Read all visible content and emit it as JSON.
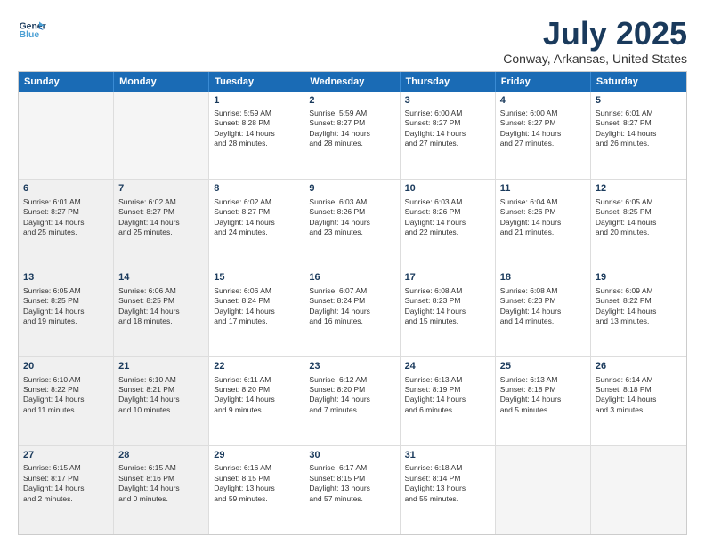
{
  "header": {
    "logo_general": "General",
    "logo_blue": "Blue",
    "month_title": "July 2025",
    "location": "Conway, Arkansas, United States"
  },
  "calendar": {
    "days_of_week": [
      "Sunday",
      "Monday",
      "Tuesday",
      "Wednesday",
      "Thursday",
      "Friday",
      "Saturday"
    ],
    "rows": [
      [
        {
          "day": "",
          "empty": true
        },
        {
          "day": "",
          "empty": true
        },
        {
          "day": "1",
          "lines": [
            "Sunrise: 5:59 AM",
            "Sunset: 8:28 PM",
            "Daylight: 14 hours",
            "and 28 minutes."
          ]
        },
        {
          "day": "2",
          "lines": [
            "Sunrise: 5:59 AM",
            "Sunset: 8:27 PM",
            "Daylight: 14 hours",
            "and 28 minutes."
          ]
        },
        {
          "day": "3",
          "lines": [
            "Sunrise: 6:00 AM",
            "Sunset: 8:27 PM",
            "Daylight: 14 hours",
            "and 27 minutes."
          ]
        },
        {
          "day": "4",
          "lines": [
            "Sunrise: 6:00 AM",
            "Sunset: 8:27 PM",
            "Daylight: 14 hours",
            "and 27 minutes."
          ]
        },
        {
          "day": "5",
          "lines": [
            "Sunrise: 6:01 AM",
            "Sunset: 8:27 PM",
            "Daylight: 14 hours",
            "and 26 minutes."
          ]
        }
      ],
      [
        {
          "day": "6",
          "shaded": true,
          "lines": [
            "Sunrise: 6:01 AM",
            "Sunset: 8:27 PM",
            "Daylight: 14 hours",
            "and 25 minutes."
          ]
        },
        {
          "day": "7",
          "shaded": true,
          "lines": [
            "Sunrise: 6:02 AM",
            "Sunset: 8:27 PM",
            "Daylight: 14 hours",
            "and 25 minutes."
          ]
        },
        {
          "day": "8",
          "lines": [
            "Sunrise: 6:02 AM",
            "Sunset: 8:27 PM",
            "Daylight: 14 hours",
            "and 24 minutes."
          ]
        },
        {
          "day": "9",
          "lines": [
            "Sunrise: 6:03 AM",
            "Sunset: 8:26 PM",
            "Daylight: 14 hours",
            "and 23 minutes."
          ]
        },
        {
          "day": "10",
          "lines": [
            "Sunrise: 6:03 AM",
            "Sunset: 8:26 PM",
            "Daylight: 14 hours",
            "and 22 minutes."
          ]
        },
        {
          "day": "11",
          "lines": [
            "Sunrise: 6:04 AM",
            "Sunset: 8:26 PM",
            "Daylight: 14 hours",
            "and 21 minutes."
          ]
        },
        {
          "day": "12",
          "lines": [
            "Sunrise: 6:05 AM",
            "Sunset: 8:25 PM",
            "Daylight: 14 hours",
            "and 20 minutes."
          ]
        }
      ],
      [
        {
          "day": "13",
          "shaded": true,
          "lines": [
            "Sunrise: 6:05 AM",
            "Sunset: 8:25 PM",
            "Daylight: 14 hours",
            "and 19 minutes."
          ]
        },
        {
          "day": "14",
          "shaded": true,
          "lines": [
            "Sunrise: 6:06 AM",
            "Sunset: 8:25 PM",
            "Daylight: 14 hours",
            "and 18 minutes."
          ]
        },
        {
          "day": "15",
          "lines": [
            "Sunrise: 6:06 AM",
            "Sunset: 8:24 PM",
            "Daylight: 14 hours",
            "and 17 minutes."
          ]
        },
        {
          "day": "16",
          "lines": [
            "Sunrise: 6:07 AM",
            "Sunset: 8:24 PM",
            "Daylight: 14 hours",
            "and 16 minutes."
          ]
        },
        {
          "day": "17",
          "lines": [
            "Sunrise: 6:08 AM",
            "Sunset: 8:23 PM",
            "Daylight: 14 hours",
            "and 15 minutes."
          ]
        },
        {
          "day": "18",
          "lines": [
            "Sunrise: 6:08 AM",
            "Sunset: 8:23 PM",
            "Daylight: 14 hours",
            "and 14 minutes."
          ]
        },
        {
          "day": "19",
          "lines": [
            "Sunrise: 6:09 AM",
            "Sunset: 8:22 PM",
            "Daylight: 14 hours",
            "and 13 minutes."
          ]
        }
      ],
      [
        {
          "day": "20",
          "shaded": true,
          "lines": [
            "Sunrise: 6:10 AM",
            "Sunset: 8:22 PM",
            "Daylight: 14 hours",
            "and 11 minutes."
          ]
        },
        {
          "day": "21",
          "shaded": true,
          "lines": [
            "Sunrise: 6:10 AM",
            "Sunset: 8:21 PM",
            "Daylight: 14 hours",
            "and 10 minutes."
          ]
        },
        {
          "day": "22",
          "lines": [
            "Sunrise: 6:11 AM",
            "Sunset: 8:20 PM",
            "Daylight: 14 hours",
            "and 9 minutes."
          ]
        },
        {
          "day": "23",
          "lines": [
            "Sunrise: 6:12 AM",
            "Sunset: 8:20 PM",
            "Daylight: 14 hours",
            "and 7 minutes."
          ]
        },
        {
          "day": "24",
          "lines": [
            "Sunrise: 6:13 AM",
            "Sunset: 8:19 PM",
            "Daylight: 14 hours",
            "and 6 minutes."
          ]
        },
        {
          "day": "25",
          "lines": [
            "Sunrise: 6:13 AM",
            "Sunset: 8:18 PM",
            "Daylight: 14 hours",
            "and 5 minutes."
          ]
        },
        {
          "day": "26",
          "lines": [
            "Sunrise: 6:14 AM",
            "Sunset: 8:18 PM",
            "Daylight: 14 hours",
            "and 3 minutes."
          ]
        }
      ],
      [
        {
          "day": "27",
          "shaded": true,
          "lines": [
            "Sunrise: 6:15 AM",
            "Sunset: 8:17 PM",
            "Daylight: 14 hours",
            "and 2 minutes."
          ]
        },
        {
          "day": "28",
          "shaded": true,
          "lines": [
            "Sunrise: 6:15 AM",
            "Sunset: 8:16 PM",
            "Daylight: 14 hours",
            "and 0 minutes."
          ]
        },
        {
          "day": "29",
          "lines": [
            "Sunrise: 6:16 AM",
            "Sunset: 8:15 PM",
            "Daylight: 13 hours",
            "and 59 minutes."
          ]
        },
        {
          "day": "30",
          "lines": [
            "Sunrise: 6:17 AM",
            "Sunset: 8:15 PM",
            "Daylight: 13 hours",
            "and 57 minutes."
          ]
        },
        {
          "day": "31",
          "lines": [
            "Sunrise: 6:18 AM",
            "Sunset: 8:14 PM",
            "Daylight: 13 hours",
            "and 55 minutes."
          ]
        },
        {
          "day": "",
          "empty": true
        },
        {
          "day": "",
          "empty": true
        }
      ]
    ]
  }
}
